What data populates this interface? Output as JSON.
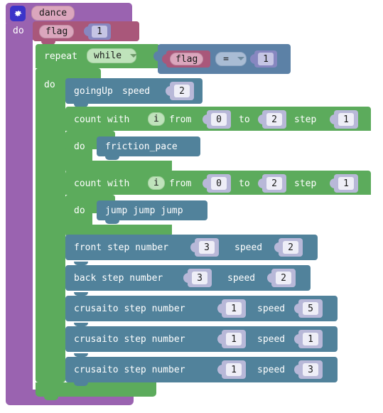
{
  "workspace": {
    "background_color": "#ffffff",
    "type": "blockly-visual-program"
  },
  "procedure": {
    "name": "dance",
    "gear_icon": "gear-icon",
    "do_label": "do",
    "color": "#9a63b0"
  },
  "set_variable": {
    "variable": "flag",
    "value": "1",
    "color": "#a9577a"
  },
  "repeat_loop": {
    "keyword": "repeat",
    "mode": "while",
    "dropdown_icon": "chevron-down-icon",
    "do_label": "do",
    "color": "#5cab5c",
    "condition": {
      "left": "flag",
      "operator": "=",
      "operator_dropdown_icon": "chevron-down-icon",
      "right": "1",
      "color": "#5c81a6"
    }
  },
  "body_blocks": [
    {
      "kind": "action",
      "name": "goingUp",
      "fields": [
        {
          "label": "speed",
          "value": "2"
        }
      ],
      "prefix": "goingUp",
      "color": "#51829b"
    },
    {
      "kind": "count-loop",
      "text_count_with": "count with",
      "var": "i",
      "text_from": "from",
      "from": "0",
      "text_to": "to",
      "to": "2",
      "text_step": "step",
      "step": "1",
      "do_label": "do",
      "inner_block": "friction_pace",
      "color": "#5cab5c"
    },
    {
      "kind": "count-loop",
      "text_count_with": "count with",
      "var": "i",
      "text_from": "from",
      "from": "0",
      "text_to": "to",
      "to": "2",
      "text_step": "step",
      "step": "1",
      "do_label": "do",
      "inner_block": "jump jump jump",
      "color": "#5cab5c"
    },
    {
      "kind": "action",
      "prefix": "front  step number",
      "step_number": "3",
      "speed_label": "speed",
      "speed": "2",
      "color": "#51829b"
    },
    {
      "kind": "action",
      "prefix": "back  step number",
      "step_number": "3",
      "speed_label": "speed",
      "speed": "2",
      "color": "#51829b"
    },
    {
      "kind": "action",
      "prefix": "crusaito  step number",
      "step_number": "1",
      "speed_label": "speed",
      "speed": "5",
      "color": "#51829b"
    },
    {
      "kind": "action",
      "prefix": "crusaito  step number",
      "step_number": "1",
      "speed_label": "speed",
      "speed": "1",
      "color": "#51829b"
    },
    {
      "kind": "action",
      "prefix": "crusaito  step number",
      "step_number": "1",
      "speed_label": "speed",
      "speed": "3",
      "color": "#51829b"
    }
  ]
}
